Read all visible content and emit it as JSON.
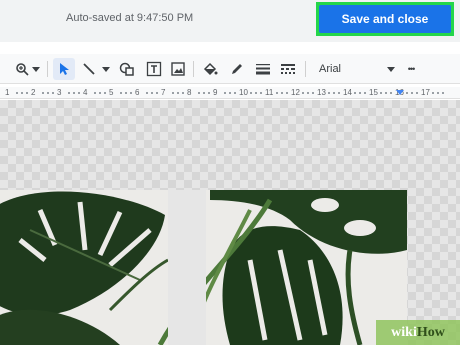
{
  "header": {
    "autosave_text": "Auto-saved at 9:47:50 PM",
    "save_label": "Save and close",
    "highlight_color": "#24d64a",
    "button_color": "#1a73e8"
  },
  "toolbar": {
    "items": [
      "zoom-icon",
      "chevron-down-icon",
      "select-arrow-icon",
      "line-icon",
      "chevron-down-icon",
      "shape-icon",
      "text-box-icon",
      "image-icon",
      "fill-color-icon",
      "pen-icon",
      "line-weight-icon",
      "line-dash-icon"
    ],
    "font": "Arial",
    "more": "•••"
  },
  "ruler": {
    "labels": [
      "1",
      "2",
      "3",
      "4",
      "5",
      "6",
      "7",
      "8",
      "9",
      "10",
      "11",
      "12",
      "13",
      "14",
      "15",
      "16",
      "17"
    ]
  },
  "watermark": {
    "part1": "wiki",
    "part2": "How"
  }
}
